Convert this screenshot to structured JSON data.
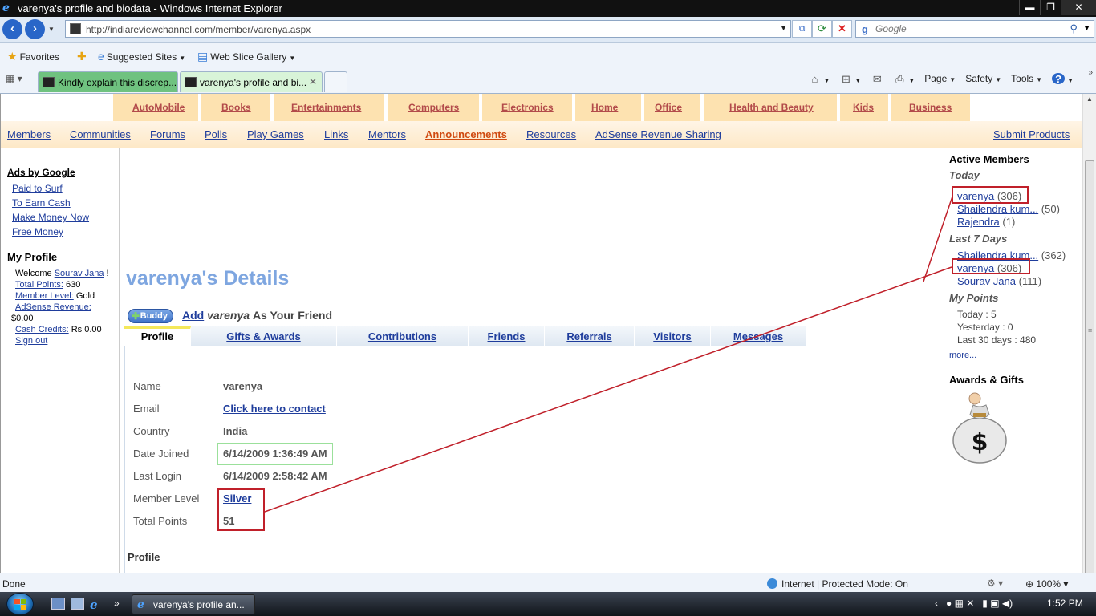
{
  "window": {
    "title": "varenya's profile and biodata - Windows Internet Explorer",
    "minimize": "▬",
    "maximize": "❐",
    "close": "✕"
  },
  "browser": {
    "url": "http://indiareviewchannel.com/member/varenya.aspx",
    "search_placeholder": "Google",
    "favorites": "Favorites",
    "suggested_sites": "Suggested Sites",
    "web_slice_gallery": "Web Slice Gallery",
    "tabs": [
      {
        "label": "Kindly explain this discrep..."
      },
      {
        "label": "varenya's profile and bi..."
      }
    ],
    "commands": {
      "page": "Page",
      "safety": "Safety",
      "tools": "Tools"
    },
    "status": {
      "done": "Done",
      "zone": "Internet | Protected Mode: On",
      "zoom": "100%"
    }
  },
  "site": {
    "categories": [
      "AutoMobile",
      "Books",
      "Entertainments",
      "Computers",
      "Electronics",
      "Home",
      "Office",
      "Health and Beauty",
      "Kids",
      "Business"
    ],
    "nav": [
      "Members",
      "Communities",
      "Forums",
      "Polls",
      "Play Games",
      "Links",
      "Mentors",
      "Announcements",
      "Resources",
      "AdSense Revenue Sharing"
    ],
    "submit_products": "Submit Products"
  },
  "left_sidebar": {
    "ads_title": "Ads by Google",
    "ads": [
      "Paid to Surf",
      "To Earn Cash",
      "Make Money Now",
      "Free Money"
    ],
    "my_profile_title": "My Profile",
    "welcome_prefix": "Welcome",
    "welcome_user": "Sourav Jana",
    "welcome_suffix": " !",
    "total_points_label": "Total Points:",
    "total_points_value": "630",
    "member_level_label": "Member Level:",
    "member_level_value": "Gold",
    "adsense_label": "AdSense Revenue:",
    "adsense_value": "$0.00",
    "cash_credits_label": "Cash Credits:",
    "cash_credits_value": "Rs 0.00",
    "sign_out": "Sign out"
  },
  "main": {
    "details_title": "varenya's Details",
    "buddy_label": "Buddy",
    "add_link": "Add",
    "add_user": "varenya",
    "add_suffix": "As Your Friend",
    "tabs": [
      "Profile",
      "Gifts & Awards",
      "Contributions",
      "Friends",
      "Referrals",
      "Visitors",
      "Messages"
    ],
    "fields": {
      "name_label": "Name",
      "name_value": "varenya",
      "email_label": "Email",
      "email_value": "Click here to contact",
      "country_label": "Country",
      "country_value": "India",
      "date_joined_label": "Date Joined",
      "date_joined_value": "6/14/2009 1:36:49 AM",
      "last_login_label": "Last Login",
      "last_login_value": "6/14/2009 2:58:42 AM",
      "member_level_label": "Member Level",
      "member_level_value": "Silver",
      "total_points_label": "Total Points",
      "total_points_value": "51"
    },
    "profile_heading": "Profile"
  },
  "right_sidebar": {
    "active_members_title": "Active Members",
    "today_label": "Today",
    "today": [
      {
        "name": "varenya",
        "count": "(306)"
      },
      {
        "name": "Shailendra kum...",
        "count": "(50)"
      },
      {
        "name": "Rajendra",
        "count": "(1)"
      }
    ],
    "last7_label": "Last 7 Days",
    "last7": [
      {
        "name": "Shailendra kum...",
        "count": "(362)"
      },
      {
        "name": "varenya",
        "count": "(306)"
      },
      {
        "name": "Sourav Jana",
        "count": "(111)"
      }
    ],
    "my_points_title": "My Points",
    "points_today": "Today : 5",
    "points_yesterday": "Yesterday : 0",
    "points_30": "Last 30 days : 480",
    "more": "more...",
    "awards_title": "Awards & Gifts",
    "bag_symbol": "$"
  },
  "taskbar": {
    "task_label": "varenya's profile an...",
    "time": "1:52 PM"
  },
  "colors": {
    "annotation_red": "#c0202a",
    "link_blue": "#1f3d9c",
    "category_red": "#b24a4a",
    "category_bg": "#fde2b0"
  }
}
